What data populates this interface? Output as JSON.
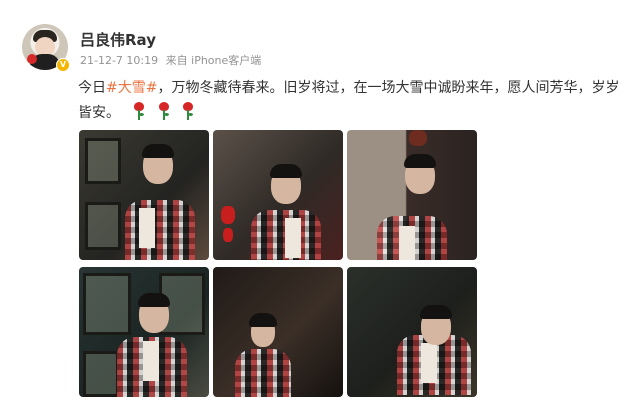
{
  "post": {
    "username": "吕良伟Ray",
    "timestamp": "21-12-7 10:19",
    "source": "来自 iPhone客户端",
    "text": {
      "before": "今日",
      "hashtag": "#大雪#",
      "after": "，万物冬藏待春来。旧岁将过，在一场大雪中诚盼来年，愿人间芳华，岁岁皆安。"
    },
    "emoji": [
      "rose-icon",
      "rose-icon",
      "rose-icon"
    ],
    "photos": [
      "photo-1",
      "photo-2",
      "photo-3",
      "photo-4",
      "photo-5",
      "photo-6"
    ]
  },
  "colors": {
    "hashtag": "#eb7340",
    "meta": "#939393",
    "text": "#333333",
    "vbadge": "#f5b600"
  }
}
